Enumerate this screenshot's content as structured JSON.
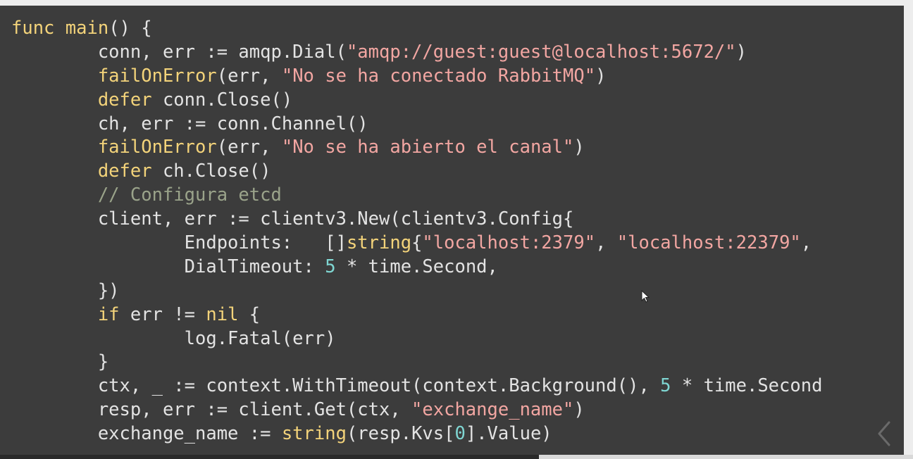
{
  "code": {
    "lines": [
      {
        "indent": "",
        "tokens": [
          {
            "t": "kw",
            "v": "func"
          },
          {
            "t": "plain",
            "v": " "
          },
          {
            "t": "fn",
            "v": "main"
          },
          {
            "t": "plain",
            "v": "() {"
          }
        ]
      },
      {
        "indent": "        ",
        "tokens": [
          {
            "t": "plain",
            "v": "conn, err := amqp.Dial("
          },
          {
            "t": "str",
            "v": "\"amqp://guest:guest@localhost:5672/\""
          },
          {
            "t": "plain",
            "v": ")"
          }
        ]
      },
      {
        "indent": "        ",
        "tokens": [
          {
            "t": "fn",
            "v": "failOnError"
          },
          {
            "t": "plain",
            "v": "(err, "
          },
          {
            "t": "str",
            "v": "\"No se ha conectado RabbitMQ\""
          },
          {
            "t": "plain",
            "v": ")"
          }
        ]
      },
      {
        "indent": "        ",
        "tokens": [
          {
            "t": "kw",
            "v": "defer"
          },
          {
            "t": "plain",
            "v": " conn.Close()"
          }
        ]
      },
      {
        "indent": "        ",
        "tokens": [
          {
            "t": "plain",
            "v": "ch, err := conn.Channel()"
          }
        ]
      },
      {
        "indent": "        ",
        "tokens": [
          {
            "t": "fn",
            "v": "failOnError"
          },
          {
            "t": "plain",
            "v": "(err, "
          },
          {
            "t": "str",
            "v": "\"No se ha abierto el canal\""
          },
          {
            "t": "plain",
            "v": ")"
          }
        ]
      },
      {
        "indent": "        ",
        "tokens": [
          {
            "t": "kw",
            "v": "defer"
          },
          {
            "t": "plain",
            "v": " ch.Close()"
          }
        ]
      },
      {
        "indent": "        ",
        "tokens": [
          {
            "t": "cmt",
            "v": "// Configura etcd"
          }
        ]
      },
      {
        "indent": "        ",
        "tokens": [
          {
            "t": "plain",
            "v": "client, err := clientv3.New(clientv3.Config{"
          }
        ]
      },
      {
        "indent": "                ",
        "tokens": [
          {
            "t": "plain",
            "v": "Endpoints:   []"
          },
          {
            "t": "kw",
            "v": "string"
          },
          {
            "t": "plain",
            "v": "{"
          },
          {
            "t": "str",
            "v": "\"localhost:2379\""
          },
          {
            "t": "plain",
            "v": ", "
          },
          {
            "t": "str",
            "v": "\"localhost:22379\""
          },
          {
            "t": "plain",
            "v": ","
          }
        ]
      },
      {
        "indent": "                ",
        "tokens": [
          {
            "t": "plain",
            "v": "DialTimeout: "
          },
          {
            "t": "num",
            "v": "5"
          },
          {
            "t": "plain",
            "v": " * time.Second,"
          }
        ]
      },
      {
        "indent": "        ",
        "tokens": [
          {
            "t": "plain",
            "v": "})"
          }
        ]
      },
      {
        "indent": "        ",
        "tokens": [
          {
            "t": "kw",
            "v": "if"
          },
          {
            "t": "plain",
            "v": " err != "
          },
          {
            "t": "kw",
            "v": "nil"
          },
          {
            "t": "plain",
            "v": " {"
          }
        ]
      },
      {
        "indent": "                ",
        "tokens": [
          {
            "t": "plain",
            "v": "log.Fatal(err)"
          }
        ]
      },
      {
        "indent": "        ",
        "tokens": [
          {
            "t": "plain",
            "v": "}"
          }
        ]
      },
      {
        "indent": "        ",
        "tokens": [
          {
            "t": "plain",
            "v": "ctx, _ := context.WithTimeout(context.Background(), "
          },
          {
            "t": "num",
            "v": "5"
          },
          {
            "t": "plain",
            "v": " * time.Second"
          }
        ]
      },
      {
        "indent": "        ",
        "tokens": [
          {
            "t": "plain",
            "v": "resp, err := client.Get(ctx, "
          },
          {
            "t": "str",
            "v": "\"exchange_name\""
          },
          {
            "t": "plain",
            "v": ")"
          }
        ]
      },
      {
        "indent": "        ",
        "tokens": [
          {
            "t": "plain",
            "v": "exchange_name := "
          },
          {
            "t": "kw",
            "v": "string"
          },
          {
            "t": "plain",
            "v": "(resp.Kvs["
          },
          {
            "t": "num",
            "v": "0"
          },
          {
            "t": "plain",
            "v": "].Value)"
          }
        ]
      }
    ]
  },
  "colors": {
    "background": "#3c3c3c",
    "text": "#e3e3e3",
    "keyword": "#f3d37a",
    "string": "#f2a6a2",
    "number": "#7fd6d2",
    "comment": "#9aa38a"
  },
  "icons": {
    "cursor": "mouse-pointer-icon",
    "nav": "chevron-left-icon"
  }
}
